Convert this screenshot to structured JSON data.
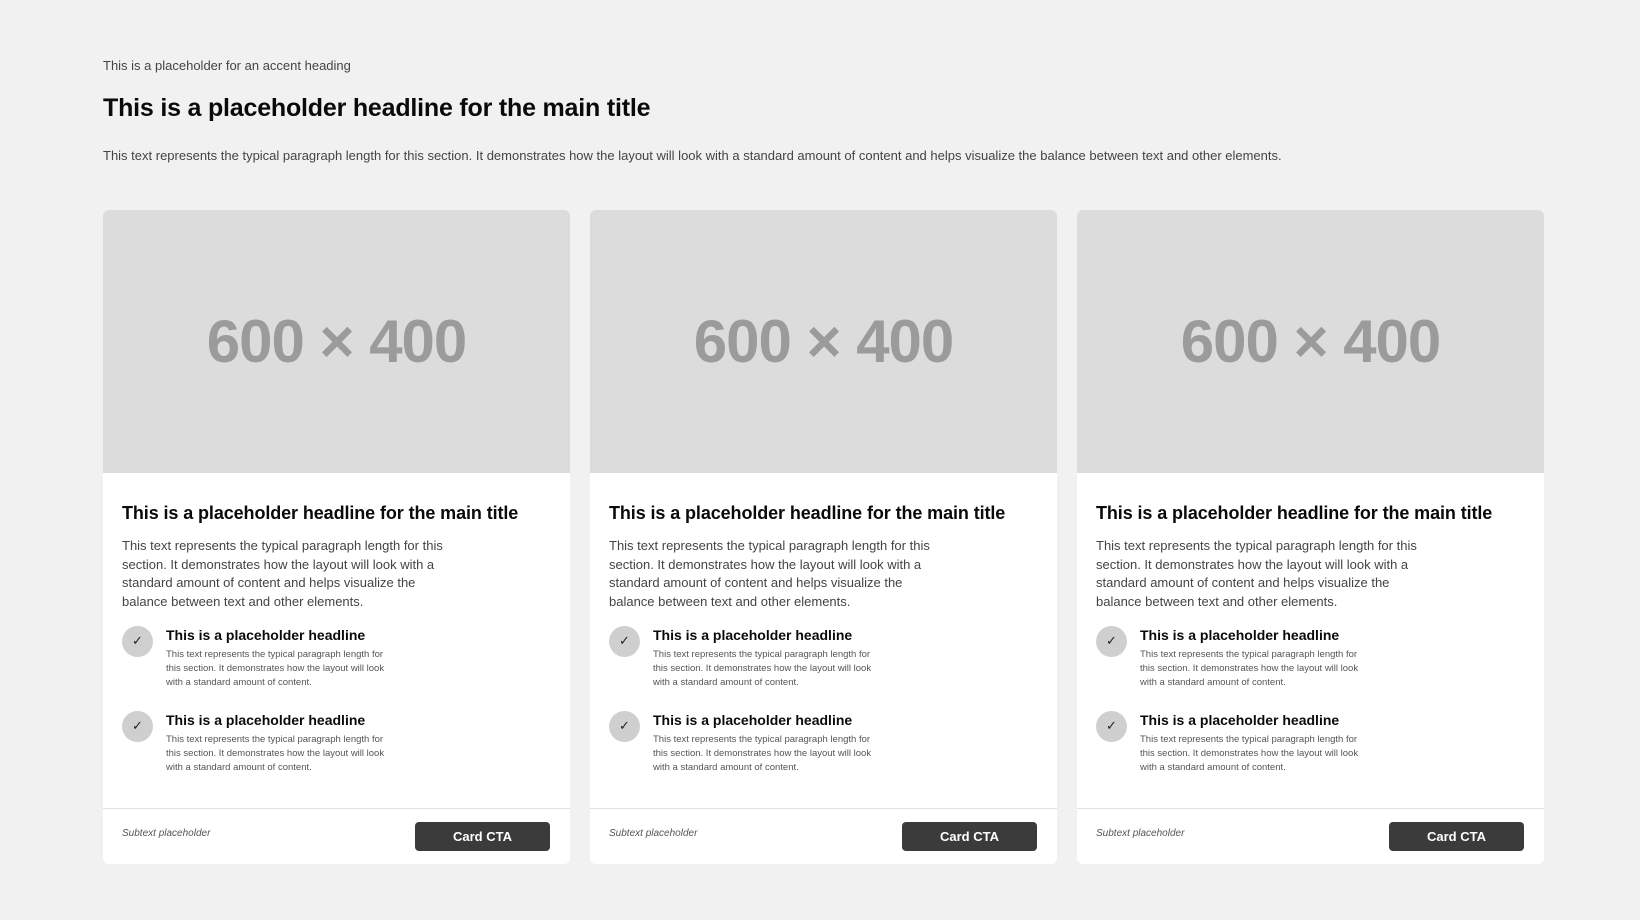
{
  "header": {
    "accent_heading": "This is a placeholder for an accent heading",
    "title": "This is a placeholder headline for the main title",
    "paragraph": "This text represents the typical paragraph length for this section. It demonstrates how the layout will look with a standard amount of content and helps visualize the balance between text and other elements."
  },
  "cards": [
    {
      "image_placeholder": "600 × 400",
      "title": "This is a placeholder headline for the main title",
      "text": "This text represents the typical paragraph length for this section. It demonstrates how the layout will look with a standard amount of content and helps visualize the balance between text and other elements.",
      "features": [
        {
          "icon": "checkmark-icon",
          "title": "This is a placeholder headline",
          "text": "This text represents the typical paragraph length for this section. It demonstrates how the layout will look with a standard amount of content."
        },
        {
          "icon": "checkmark-icon",
          "title": "This is a placeholder headline",
          "text": "This text represents the typical paragraph length for this section. It demonstrates how the layout will look with a standard amount of content."
        }
      ],
      "subtext": "Subtext placeholder",
      "cta_label": "Card CTA"
    },
    {
      "image_placeholder": "600 × 400",
      "title": "This is a placeholder headline for the main title",
      "text": "This text represents the typical paragraph length for this section. It demonstrates how the layout will look with a standard amount of content and helps visualize the balance between text and other elements.",
      "features": [
        {
          "icon": "checkmark-icon",
          "title": "This is a placeholder headline",
          "text": "This text represents the typical paragraph length for this section. It demonstrates how the layout will look with a standard amount of content."
        },
        {
          "icon": "checkmark-icon",
          "title": "This is a placeholder headline",
          "text": "This text represents the typical paragraph length for this section. It demonstrates how the layout will look with a standard amount of content."
        }
      ],
      "subtext": "Subtext placeholder",
      "cta_label": "Card CTA"
    },
    {
      "image_placeholder": "600 × 400",
      "title": "This is a placeholder headline for the main title",
      "text": "This text represents the typical paragraph length for this section. It demonstrates how the layout will look with a standard amount of content and helps visualize the balance between text and other elements.",
      "features": [
        {
          "icon": "checkmark-icon",
          "title": "This is a placeholder headline",
          "text": "This text represents the typical paragraph length for this section. It demonstrates how the layout will look with a standard amount of content."
        },
        {
          "icon": "checkmark-icon",
          "title": "This is a placeholder headline",
          "text": "This text represents the typical paragraph length for this section. It demonstrates how the layout will look with a standard amount of content."
        }
      ],
      "subtext": "Subtext placeholder",
      "cta_label": "Card CTA"
    }
  ],
  "colors": {
    "page_background": "#f1f1f1",
    "card_background": "#ffffff",
    "image_placeholder_bg": "#dcdcdc",
    "image_placeholder_text": "#9b9b9b",
    "cta_background": "#3b3b3b",
    "check_circle": "#cfcfcf"
  }
}
